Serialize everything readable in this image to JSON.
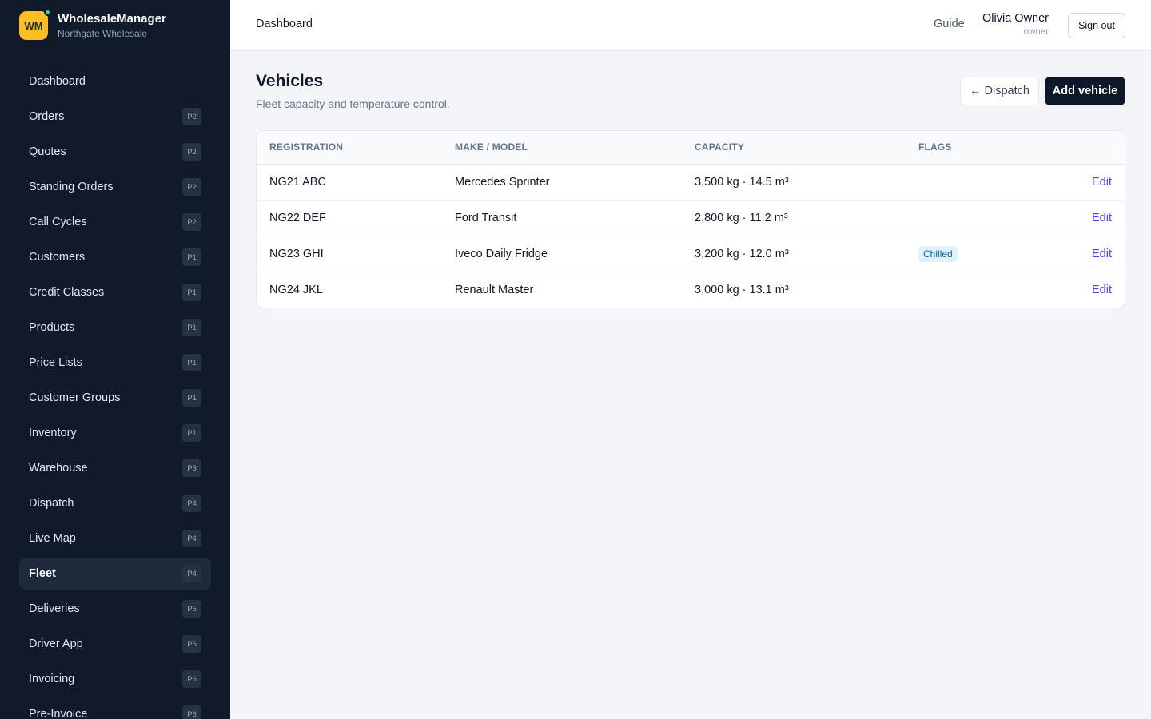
{
  "brand": {
    "logo_text": "WM",
    "name": "WholesaleManager",
    "subtitle": "Northgate Wholesale"
  },
  "sidebar": {
    "items": [
      {
        "label": "Dashboard",
        "badge": ""
      },
      {
        "label": "Orders",
        "badge": "P2"
      },
      {
        "label": "Quotes",
        "badge": "P2"
      },
      {
        "label": "Standing Orders",
        "badge": "P2"
      },
      {
        "label": "Call Cycles",
        "badge": "P2"
      },
      {
        "label": "Customers",
        "badge": "P1"
      },
      {
        "label": "Credit Classes",
        "badge": "P1"
      },
      {
        "label": "Products",
        "badge": "P1"
      },
      {
        "label": "Price Lists",
        "badge": "P1"
      },
      {
        "label": "Customer Groups",
        "badge": "P1"
      },
      {
        "label": "Inventory",
        "badge": "P1"
      },
      {
        "label": "Warehouse",
        "badge": "P3"
      },
      {
        "label": "Dispatch",
        "badge": "P4"
      },
      {
        "label": "Live Map",
        "badge": "P4"
      },
      {
        "label": "Fleet",
        "badge": "P4",
        "active": true
      },
      {
        "label": "Deliveries",
        "badge": "P5"
      },
      {
        "label": "Driver App",
        "badge": "P5"
      },
      {
        "label": "Invoicing",
        "badge": "P6"
      },
      {
        "label": "Pre-Invoice",
        "badge": "P6"
      }
    ]
  },
  "header": {
    "breadcrumb": "Dashboard",
    "guide_label": "Guide",
    "user_name": "Olivia Owner",
    "user_role": "owner",
    "signout_label": "Sign out"
  },
  "page": {
    "title": "Vehicles",
    "subtitle": "Fleet capacity and temperature control.",
    "back_button": "← Dispatch",
    "add_button": "Add vehicle"
  },
  "table": {
    "columns": [
      "REGISTRATION",
      "MAKE / MODEL",
      "CAPACITY",
      "FLAGS",
      ""
    ],
    "rows": [
      {
        "registration": "NG21 ABC",
        "model": "Mercedes Sprinter",
        "capacity": "3,500 kg · 14.5 m³",
        "flag": "",
        "action": "Edit"
      },
      {
        "registration": "NG22 DEF",
        "model": "Ford Transit",
        "capacity": "2,800 kg · 11.2 m³",
        "flag": "",
        "action": "Edit"
      },
      {
        "registration": "NG23 GHI",
        "model": "Iveco Daily Fridge",
        "capacity": "3,200 kg · 12.0 m³",
        "flag": "Chilled",
        "action": "Edit"
      },
      {
        "registration": "NG24 JKL",
        "model": "Renault Master",
        "capacity": "3,000 kg · 13.1 m³",
        "flag": "",
        "action": "Edit"
      }
    ]
  },
  "colors": {
    "sidebar_bg": "#111a2b",
    "active_item_bg": "#1e293b",
    "logo_bg": "#fbbf24",
    "status_dot": "#34d399",
    "primary_button": "#0f172a",
    "link": "#4f46e5",
    "chilled_badge_bg": "#e0f2fe",
    "chilled_badge_text": "#0369a1"
  }
}
